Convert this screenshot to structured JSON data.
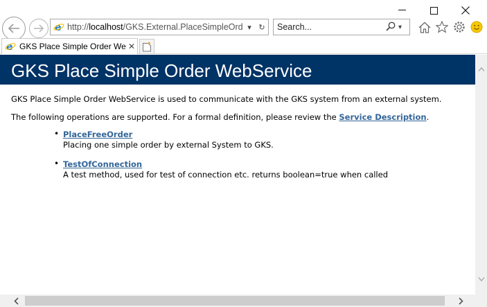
{
  "window": {
    "minimize_icon": "minimize-icon",
    "maximize_icon": "maximize-icon",
    "close_icon": "close-icon"
  },
  "address_bar": {
    "url_prefix": "http://",
    "url_host": "localhost",
    "url_path": "/GKS.External.PlaceSimpleOrder.",
    "dropdown_glyph": "▾",
    "refresh_glyph": "↻"
  },
  "search": {
    "placeholder": "Search...",
    "value": "Search...",
    "dropdown_glyph": "▾"
  },
  "tabs": [
    {
      "title": "GKS Place Simple Order We...",
      "close_glyph": "✕"
    }
  ],
  "page": {
    "heading": "GKS Place Simple Order WebService",
    "intro": "GKS Place Simple Order WebService is used to communicate with the GKS system from an external system.",
    "operations_text": "The following operations are supported. For a formal definition, please review the ",
    "service_description_link": "Service Description",
    "operations_text_end": ".",
    "operations": [
      {
        "name": "PlaceFreeOrder",
        "description": "Placing one simple order by external System to GKS."
      },
      {
        "name": "TestOfConnection",
        "description": "A test method, used for test of connection etc. returns boolean=true when called"
      }
    ]
  },
  "colors": {
    "banner_bg": "#003366",
    "link": "#336699",
    "ie_blue": "#1e7bd6",
    "ie_ring": "#f4c300"
  }
}
